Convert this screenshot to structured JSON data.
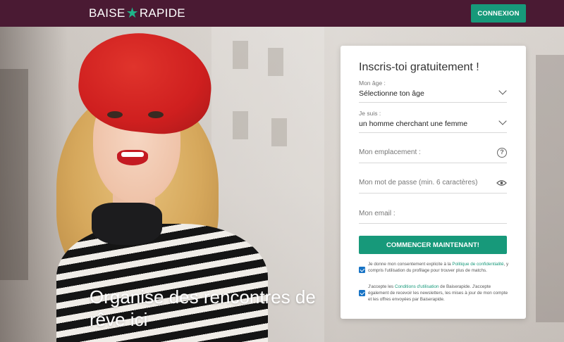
{
  "header": {
    "logo_left": "BAISE",
    "logo_right": "RAPIDE",
    "login_label": "CONNEXION"
  },
  "hero": {
    "headline": "Organise des rencontres de rêve ici"
  },
  "form": {
    "title": "Inscris-toi gratuitement !",
    "age": {
      "label": "Mon âge :",
      "value": "Sélectionne ton âge"
    },
    "iam": {
      "label": "Je suis :",
      "value": "un homme cherchant une femme"
    },
    "location": {
      "placeholder": "Mon emplacement :"
    },
    "password": {
      "placeholder": "Mon mot de passe (min. 6 caractères)"
    },
    "email": {
      "placeholder": "Mon email :"
    },
    "submit_label": "COMMENCER MAINTENANT!",
    "consent1": {
      "text_before": "Je donne mon consentement explicite à la ",
      "link": "Politique de confidentialité",
      "text_after": ", y compris l'utilisation du profilage pour trouver plus de matchs.",
      "checked": true
    },
    "consent2": {
      "text_before": "J'accepte les ",
      "link": "Conditions d'utilisation",
      "text_after": " de Baiserapide. J'accepte également de recevoir les newsletters, les mises à jour de mon compte et les offres envoyées par Baiserapide.",
      "checked": true
    }
  },
  "colors": {
    "header_bg": "#4a1a33",
    "accent": "#17997a",
    "checkbox": "#1773c5",
    "beret": "#cf1f1f"
  }
}
